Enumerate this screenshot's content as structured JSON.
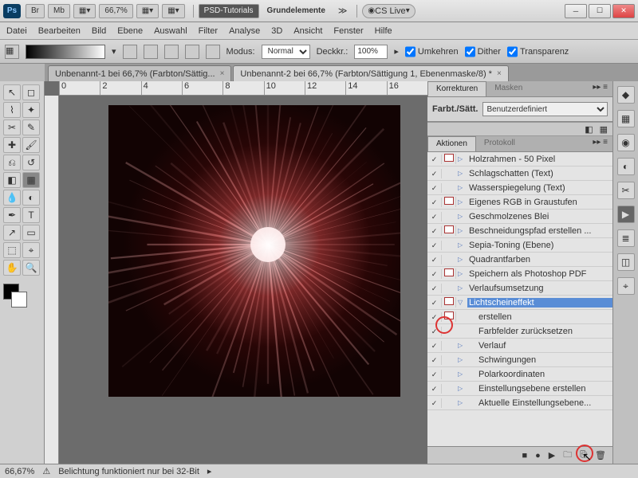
{
  "titlebar": {
    "br": "Br",
    "mb": "Mb",
    "zoom": "66,7%",
    "workspace": "PSD-Tutorials",
    "workspace2": "Grundelemente",
    "cslive": "CS Live"
  },
  "menu": [
    "Datei",
    "Bearbeiten",
    "Bild",
    "Ebene",
    "Auswahl",
    "Filter",
    "Analyse",
    "3D",
    "Ansicht",
    "Fenster",
    "Hilfe"
  ],
  "opt": {
    "modus_lbl": "Modus:",
    "modus": "Normal",
    "deck_lbl": "Deckkr.:",
    "deck": "100%",
    "umkehren": "Umkehren",
    "dither": "Dither",
    "transparenz": "Transparenz"
  },
  "tabs": [
    {
      "label": "Unbenannt-1 bei 66,7% (Farbton/Sättig...",
      "active": false
    },
    {
      "label": "Unbenannt-2 bei 66,7% (Farbton/Sättigung 1, Ebenenmaske/8) *",
      "active": true
    }
  ],
  "panels": {
    "korrekturen_tab": "Korrekturen",
    "masken_tab": "Masken",
    "farbt_label": "Farbt./Sätt.",
    "farbt_preset": "Benutzerdefiniert",
    "aktionen_tab": "Aktionen",
    "protokoll_tab": "Protokoll"
  },
  "actions": [
    {
      "check": true,
      "dlg": true,
      "tri": "▷",
      "name": "Holzrahmen - 50 Pixel",
      "indent": 0
    },
    {
      "check": true,
      "dlg": false,
      "tri": "▷",
      "name": "Schlagschatten (Text)",
      "indent": 0
    },
    {
      "check": true,
      "dlg": false,
      "tri": "▷",
      "name": "Wasserspiegelung (Text)",
      "indent": 0
    },
    {
      "check": true,
      "dlg": true,
      "tri": "▷",
      "name": "Eigenes RGB in Graustufen",
      "indent": 0
    },
    {
      "check": true,
      "dlg": false,
      "tri": "▷",
      "name": "Geschmolzenes Blei",
      "indent": 0
    },
    {
      "check": true,
      "dlg": true,
      "tri": "▷",
      "name": "Beschneidungspfad erstellen ...",
      "indent": 0
    },
    {
      "check": true,
      "dlg": false,
      "tri": "▷",
      "name": "Sepia-Toning (Ebene)",
      "indent": 0
    },
    {
      "check": true,
      "dlg": false,
      "tri": "▷",
      "name": "Quadrantfarben",
      "indent": 0
    },
    {
      "check": true,
      "dlg": true,
      "tri": "▷",
      "name": "Speichern als Photoshop PDF",
      "indent": 0
    },
    {
      "check": true,
      "dlg": false,
      "tri": "▷",
      "name": "Verlaufsumsetzung",
      "indent": 0
    },
    {
      "check": true,
      "dlg": true,
      "tri": "▽",
      "name": "Lichtscheineffekt",
      "indent": 0,
      "sel": true
    },
    {
      "check": true,
      "dlg": true,
      "tri": "",
      "name": "erstellen",
      "indent": 1
    },
    {
      "check": true,
      "dlg": false,
      "tri": "",
      "name": "Farbfelder zurücksetzen",
      "indent": 1
    },
    {
      "check": true,
      "dlg": false,
      "tri": "▷",
      "name": "Verlauf",
      "indent": 1
    },
    {
      "check": true,
      "dlg": false,
      "tri": "▷",
      "name": "Schwingungen",
      "indent": 1
    },
    {
      "check": true,
      "dlg": false,
      "tri": "▷",
      "name": "Polarkoordinaten",
      "indent": 1
    },
    {
      "check": true,
      "dlg": false,
      "tri": "▷",
      "name": "Einstellungsebene erstellen",
      "indent": 1
    },
    {
      "check": true,
      "dlg": false,
      "tri": "▷",
      "name": "Aktuelle Einstellungsebene...",
      "indent": 1
    }
  ],
  "status": {
    "zoom": "66,67%",
    "msg": "Belichtung funktioniert nur bei 32-Bit"
  },
  "ruler": [
    "0",
    "2",
    "4",
    "6",
    "8",
    "10",
    "12",
    "14",
    "16"
  ]
}
